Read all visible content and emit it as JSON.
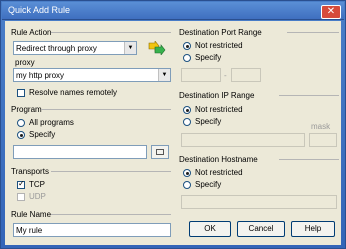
{
  "window": {
    "title": "Quick Add Rule",
    "close_glyph": "✕"
  },
  "rule_action": {
    "label": "Rule Action",
    "action_value": "Redirect through proxy",
    "proxy_label": "proxy",
    "proxy_value": "my http proxy",
    "resolve_label": "Resolve names remotely",
    "resolve_checked": false
  },
  "program": {
    "label": "Program",
    "all_label": "All programs",
    "specify_label": "Specify",
    "selected": "specify",
    "path_value": ""
  },
  "transports": {
    "label": "Transports",
    "tcp_label": "TCP",
    "tcp_checked": true,
    "udp_label": "UDP",
    "udp_checked": false
  },
  "rule_name": {
    "label": "Rule Name",
    "value": "My rule"
  },
  "dest_port": {
    "label": "Destination Port Range",
    "not_restricted_label": "Not restricted",
    "specify_label": "Specify",
    "selected": "not_restricted",
    "separator": "-"
  },
  "dest_ip": {
    "label": "Destination IP Range",
    "not_restricted_label": "Not restricted",
    "specify_label": "Specify",
    "selected": "not_restricted",
    "mask_label": "mask"
  },
  "dest_host": {
    "label": "Destination Hostname",
    "not_restricted_label": "Not restricted",
    "specify_label": "Specify",
    "selected": "not_restricted"
  },
  "buttons": {
    "ok": "OK",
    "cancel": "Cancel",
    "help": "Help"
  },
  "icons": {
    "arrow_icon": "green-yellow-arrows-icon",
    "combo_arrow": "▼"
  },
  "colors": {
    "titlebar": "#3f6fc0",
    "dialog_bg": "#ece9d8"
  }
}
